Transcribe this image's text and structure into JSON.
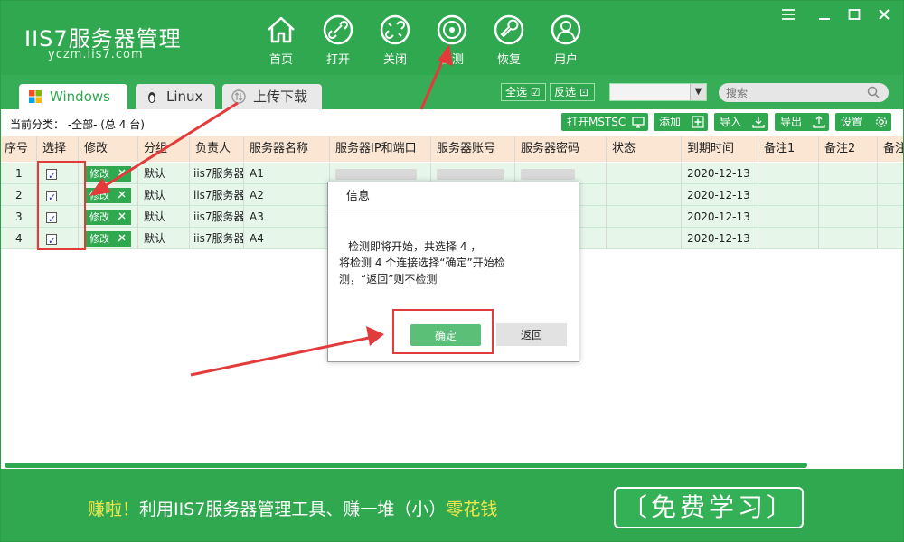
{
  "app": {
    "logo_title": "IIS7服务器管理",
    "logo_url": "yczm.iis7.com"
  },
  "nav": [
    {
      "key": "home",
      "label": "首页",
      "icon": "home-icon"
    },
    {
      "key": "open",
      "label": "打开",
      "icon": "link-icon"
    },
    {
      "key": "close",
      "label": "关闭",
      "icon": "unlink-icon"
    },
    {
      "key": "detect",
      "label": "检测",
      "icon": "radar-icon"
    },
    {
      "key": "restore",
      "label": "恢复",
      "icon": "wrench-icon"
    },
    {
      "key": "user",
      "label": "用户",
      "icon": "user-icon"
    }
  ],
  "tabs": [
    {
      "label": "Windows",
      "icon": "windows-icon"
    },
    {
      "label": "Linux",
      "icon": "linux-icon"
    },
    {
      "label": "上传下载",
      "icon": "upload-download-icon"
    }
  ],
  "toolbar": {
    "select_all": "全选",
    "invert_select": "反选",
    "search_placeholder": "搜索",
    "category_label": "当前分类： -全部- (总 4 台)",
    "open_mstsc": "打开MSTSC",
    "add": "添加",
    "import": "导入",
    "export": "导出",
    "settings": "设置"
  },
  "table": {
    "headers": [
      "序号",
      "选择",
      "修改",
      "分组",
      "负责人",
      "服务器名称",
      "服务器IP和端口",
      "服务器账号",
      "服务器密码",
      "状态",
      "到期时间",
      "备注1",
      "备注2",
      "备注"
    ],
    "edit_label": "修改",
    "rows": [
      {
        "index": "1",
        "group": "默认",
        "owner": "iis7服务器",
        "name": "A1",
        "expiry": "2020-12-13"
      },
      {
        "index": "2",
        "group": "默认",
        "owner": "iis7服务器",
        "name": "A2",
        "expiry": "2020-12-13"
      },
      {
        "index": "3",
        "group": "默认",
        "owner": "iis7服务器",
        "name": "A3",
        "expiry": "2020-12-13"
      },
      {
        "index": "4",
        "group": "默认",
        "owner": "iis7服务器",
        "name": "A4",
        "expiry": "2020-12-13"
      }
    ]
  },
  "dialog": {
    "title": "信息",
    "message_line1": "检测即将开始，共选择 4 ，",
    "message_line2": "将检测 4 个连接选择“确定”开始检",
    "message_line3": "测，“返回”则不检测",
    "ok": "确定",
    "back": "返回"
  },
  "banner": {
    "prefix": "赚啦！",
    "middle": "利用IIS7服务器管理工具、赚一堆（小）",
    "suffix": "零花钱",
    "cta": "〔免费学习〕"
  },
  "colors": {
    "brand_green": "#2fa84f",
    "header_row": "#fbe6d4",
    "row_bg": "#e6f7ea",
    "annotation_red": "#e23b3b",
    "banner_highlight": "#f4e64a"
  }
}
